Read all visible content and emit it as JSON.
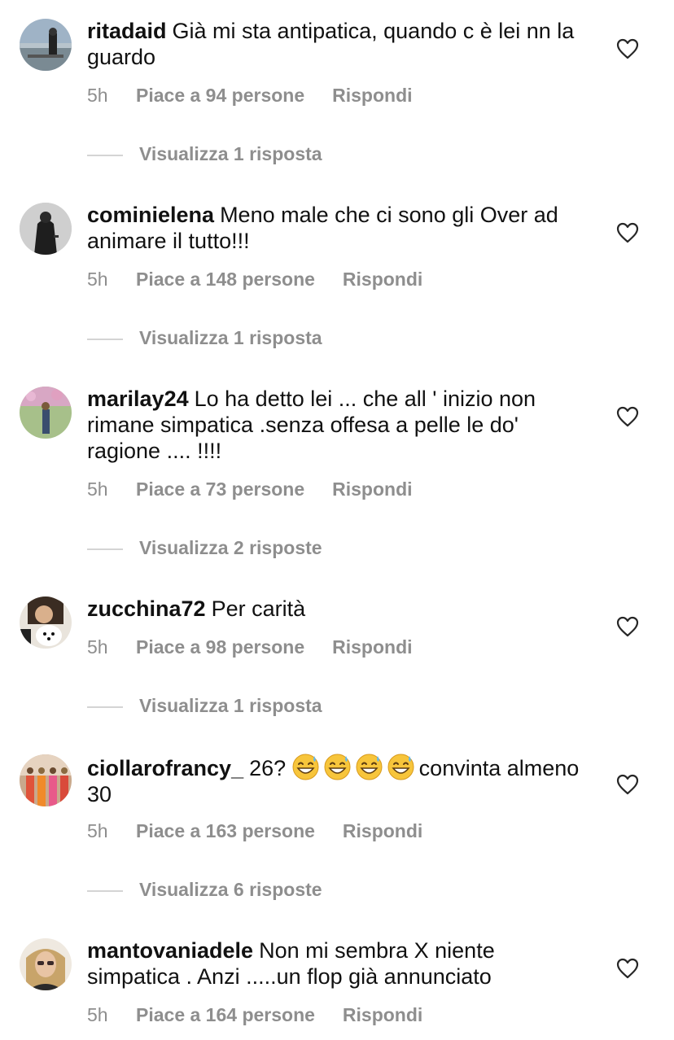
{
  "ui": {
    "heart_icon": "heart-outline-icon",
    "meta_color": "#8e8e8e",
    "text_color": "#111111"
  },
  "comments": [
    {
      "username": "ritadaid",
      "text": "Già mi sta antipatica, quando c è lei nn la guardo",
      "time": "5h",
      "likes": "Piace a 94 persone",
      "reply": "Rispondi",
      "view_replies": "Visualizza 1 risposta"
    },
    {
      "username": "cominielena",
      "text": "Meno male che ci sono gli Over ad animare il tutto!!!",
      "time": "5h",
      "likes": "Piace a 148 persone",
      "reply": "Rispondi",
      "view_replies": "Visualizza 1 risposta"
    },
    {
      "username": "marilay24",
      "text": "Lo ha detto lei ... che all ' inizio non rimane simpatica .senza offesa a pelle le do' ragione .... !!!!",
      "time": "5h",
      "likes": "Piace a 73 persone",
      "reply": "Rispondi",
      "view_replies": "Visualizza 2 risposte"
    },
    {
      "username": "zucchina72",
      "text": "Per carità",
      "time": "5h",
      "likes": "Piace a 98 persone",
      "reply": "Rispondi",
      "view_replies": "Visualizza 1 risposta"
    },
    {
      "username": "ciollarofrancy_",
      "text_before": "26?",
      "emojis": [
        "grinning-sweat-emoji",
        "grinning-sweat-emoji",
        "grinning-sweat-emoji",
        "grinning-sweat-emoji"
      ],
      "text_after": "convinta almeno 30",
      "time": "5h",
      "likes": "Piace a 163 persone",
      "reply": "Rispondi",
      "view_replies": "Visualizza 6 risposte"
    },
    {
      "username": "mantovaniadele",
      "text": "Non mi sembra X niente simpatica . Anzi .....un flop già annunciato",
      "time": "5h",
      "likes": "Piace a 164 persone",
      "reply": "Rispondi"
    }
  ]
}
